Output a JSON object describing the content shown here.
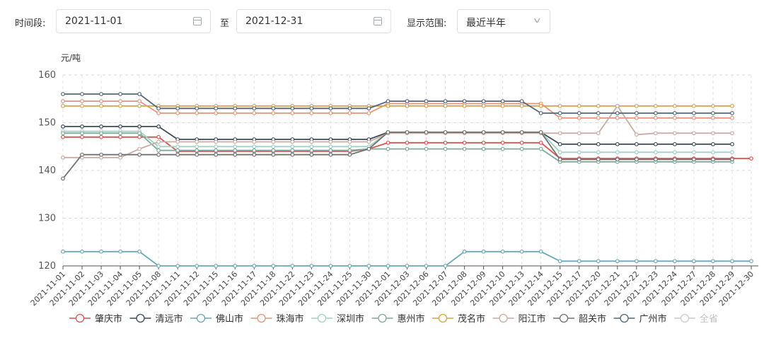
{
  "filters": {
    "period_label": "时间段:",
    "start_date": "2021-11-01",
    "to_label": "至",
    "end_date": "2021-12-31",
    "range_label": "显示范围:",
    "range_value": "最近半年"
  },
  "chart_data": {
    "type": "line",
    "ylabel": "元/吨",
    "ylim": [
      120,
      160
    ],
    "yticks": [
      120,
      130,
      140,
      150,
      160
    ],
    "grid": true,
    "legend_position": "bottom",
    "categories": [
      "2021-11-01",
      "2021-11-02",
      "2021-11-03",
      "2021-11-04",
      "2021-11-05",
      "2021-11-08",
      "2021-11-11",
      "2021-11-12",
      "2021-11-15",
      "2021-11-16",
      "2021-11-17",
      "2021-11-18",
      "2021-11-22",
      "2021-11-23",
      "2021-11-24",
      "2021-11-25",
      "2021-11-30",
      "2021-12-01",
      "2021-12-03",
      "2021-12-06",
      "2021-12-07",
      "2021-12-08",
      "2021-12-09",
      "2021-12-10",
      "2021-12-13",
      "2021-12-14",
      "2021-12-15",
      "2021-12-17",
      "2021-12-20",
      "2021-12-21",
      "2021-12-22",
      "2021-12-23",
      "2021-12-24",
      "2021-12-27",
      "2021-12-28",
      "2021-12-29",
      "2021-12-30"
    ],
    "series": [
      {
        "name": "肇庆市",
        "color": "#d9534f",
        "values": [
          147,
          147,
          147,
          147,
          147,
          147,
          144,
          144,
          144,
          144,
          144,
          144,
          144,
          144,
          144,
          144,
          144.5,
          145.8,
          145.8,
          145.8,
          145.8,
          145.8,
          145.8,
          145.8,
          145.8,
          145.8,
          142.5,
          142.5,
          142.5,
          142.5,
          142.5,
          142.5,
          142.5,
          142.5,
          142.5,
          142.5,
          142.5
        ]
      },
      {
        "name": "清远市",
        "color": "#3b4a5c",
        "values": [
          149.2,
          149.2,
          149.2,
          149.2,
          149.2,
          149.2,
          146.5,
          146.5,
          146.5,
          146.5,
          146.5,
          146.5,
          146.5,
          146.5,
          146.5,
          146.5,
          146.5,
          148,
          148,
          148,
          148,
          148,
          148,
          148,
          148,
          148,
          145.5,
          145.5,
          145.5,
          145.5,
          145.5,
          145.5,
          145.5,
          145.5,
          145.5,
          145.5,
          null
        ]
      },
      {
        "name": "佛山市",
        "color": "#6aa9b5",
        "values": [
          123,
          123,
          123,
          123,
          123,
          120,
          120,
          120,
          120,
          120,
          120,
          120,
          120,
          120,
          120,
          120,
          120,
          120,
          120,
          120,
          120,
          123,
          123,
          123,
          123,
          123,
          121,
          121,
          121,
          121,
          121,
          121,
          121,
          121,
          121,
          121,
          121
        ]
      },
      {
        "name": "珠海市",
        "color": "#e0967a",
        "values": [
          154.5,
          154.5,
          154.5,
          154.5,
          154.5,
          152,
          152,
          152,
          152,
          152,
          152,
          152,
          152,
          152,
          152,
          152,
          152,
          154,
          154,
          154,
          154,
          154,
          154,
          154,
          154,
          154,
          151,
          151,
          151,
          151,
          151,
          151,
          151,
          151,
          151,
          151,
          null
        ]
      },
      {
        "name": "深圳市",
        "color": "#9fd3c2",
        "values": [
          148.2,
          148.2,
          148.2,
          148.2,
          148.2,
          145,
          145,
          145,
          145,
          145,
          145,
          145,
          145,
          145,
          145,
          145,
          145,
          148,
          148,
          148,
          148,
          148,
          148,
          148,
          148,
          148,
          143.8,
          143.8,
          143.8,
          143.8,
          143.8,
          143.8,
          143.8,
          143.8,
          143.8,
          143.8,
          null
        ]
      },
      {
        "name": "惠州市",
        "color": "#7fa99a",
        "values": [
          147.8,
          147.8,
          147.8,
          147.8,
          147.8,
          144.2,
          144.2,
          144.2,
          144.2,
          144.2,
          144.2,
          144.2,
          144.2,
          144.2,
          144.2,
          144.2,
          144.5,
          144.5,
          144.5,
          144.5,
          144.5,
          144.5,
          144.5,
          144.5,
          144.5,
          144.5,
          141.8,
          141.8,
          141.8,
          141.8,
          141.8,
          141.8,
          141.8,
          141.8,
          141.8,
          141.8,
          null
        ]
      },
      {
        "name": "茂名市",
        "color": "#d9a441",
        "values": [
          153.5,
          153.5,
          153.5,
          153.5,
          153.5,
          153.5,
          153.5,
          153.5,
          153.5,
          153.5,
          153.5,
          153.5,
          153.5,
          153.5,
          153.5,
          153.5,
          153.5,
          153.5,
          153.5,
          153.5,
          153.5,
          153.5,
          153.5,
          153.5,
          153.5,
          153.5,
          153.5,
          153.5,
          153.5,
          153.5,
          153.5,
          153.5,
          153.5,
          153.5,
          153.5,
          153.5,
          null
        ]
      },
      {
        "name": "阳江市",
        "color": "#c9aca4",
        "values": [
          142.7,
          142.7,
          142.7,
          142.7,
          144.5,
          146,
          146,
          146,
          146,
          146,
          146,
          146,
          146,
          146,
          146,
          146,
          146,
          147.8,
          147.8,
          147.8,
          147.8,
          147.8,
          147.8,
          147.8,
          147.8,
          147.8,
          147.8,
          147.8,
          147.8,
          153.5,
          147.5,
          147.8,
          147.8,
          147.8,
          147.8,
          147.8,
          null
        ]
      },
      {
        "name": "韶关市",
        "color": "#717171",
        "values": [
          138.3,
          143.3,
          143.3,
          143.3,
          143.3,
          143.3,
          143.3,
          143.3,
          143.3,
          143.3,
          143.3,
          143.3,
          143.3,
          143.3,
          143.3,
          143.3,
          144.5,
          148,
          148,
          148,
          148,
          148,
          148,
          148,
          148,
          148,
          142.3,
          142.3,
          142.3,
          142.3,
          142.3,
          142.3,
          142.3,
          142.3,
          142.3,
          142.3,
          null
        ]
      },
      {
        "name": "广州市",
        "color": "#55677a",
        "values": [
          156,
          156,
          156,
          156,
          156,
          153,
          153,
          153,
          153,
          153,
          153,
          153,
          153,
          153,
          153,
          153,
          153,
          154.5,
          154.5,
          154.5,
          154.5,
          154.5,
          154.5,
          154.5,
          154.5,
          152,
          152,
          152,
          152,
          152,
          152,
          152,
          152,
          152,
          152,
          152,
          null
        ]
      },
      {
        "name": "全省",
        "color": "#cccccc",
        "legend_only": true,
        "values": []
      }
    ]
  }
}
